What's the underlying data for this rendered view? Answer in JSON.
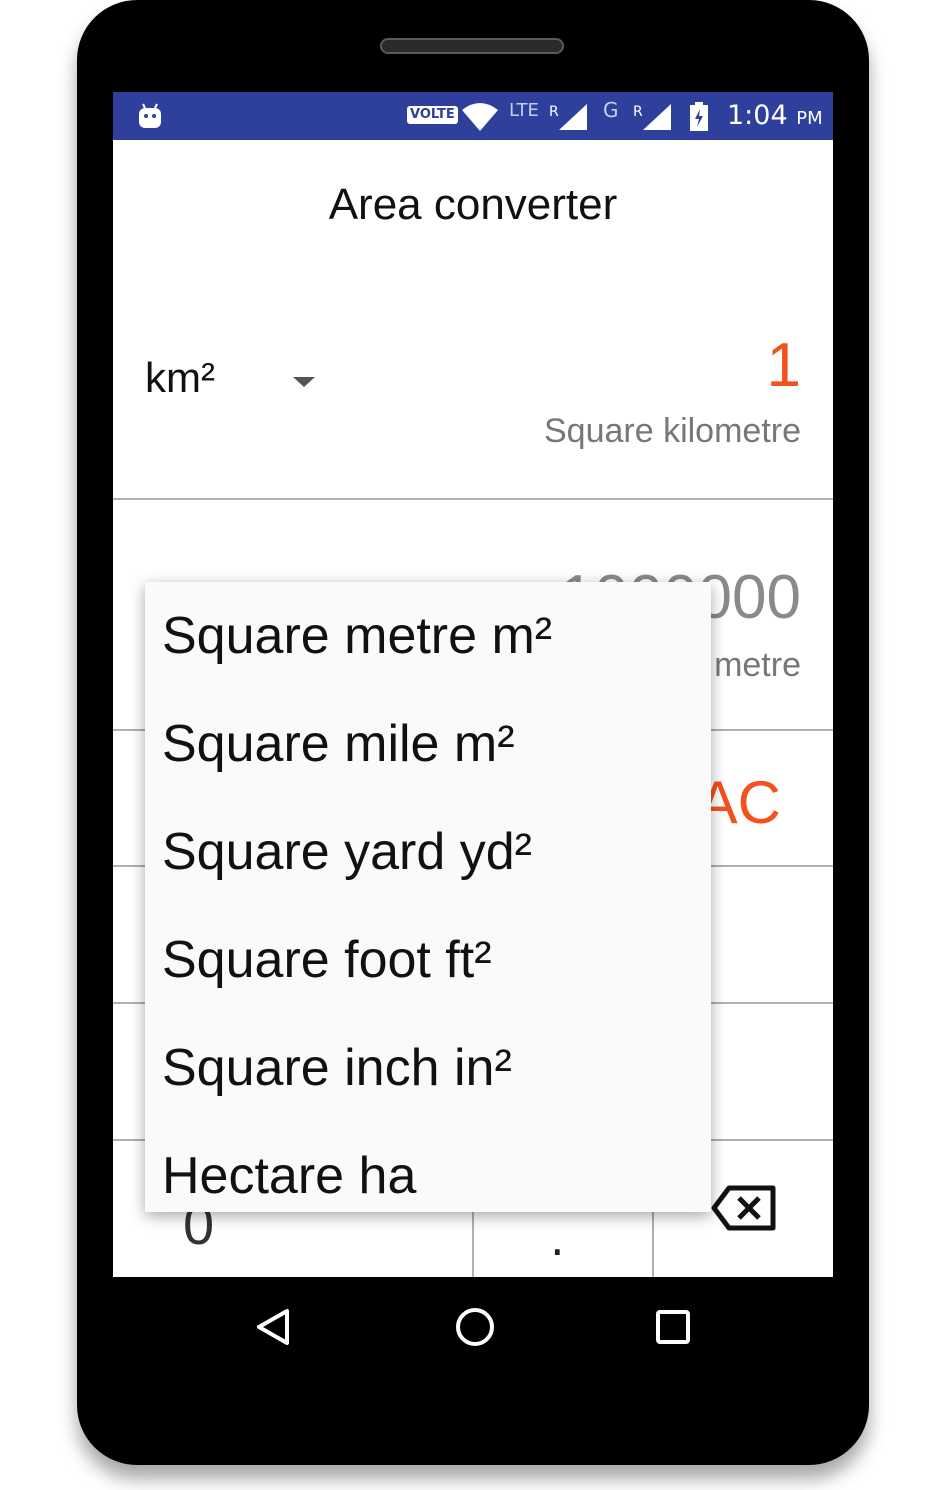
{
  "status_bar": {
    "volte": "VOLTE",
    "lte": "LTE",
    "roaming_1": "R",
    "network_2": "G",
    "roaming_2": "R",
    "time": "1:04",
    "ampm": "PM"
  },
  "app": {
    "title": "Area converter"
  },
  "from_unit": {
    "symbol": "km²",
    "value": "1",
    "name": "Square kilometre"
  },
  "to_unit": {
    "value": "1000000",
    "name_partial": "metre"
  },
  "keypad": {
    "ac": "AC",
    "zero": "0",
    "dot": "."
  },
  "dropdown_menu": {
    "items": [
      "Square metre m²",
      "Square mile m²",
      "Square yard yd²",
      "Square foot ft²",
      "Square inch in²",
      "Hectare ha"
    ]
  },
  "colors": {
    "status_bar": "#2f3f9c",
    "accent": "#f4511e"
  },
  "icons": {
    "status": [
      "android-icon",
      "wifi-icon",
      "signal-icon",
      "battery-charging-icon"
    ],
    "nav": [
      "back-icon",
      "home-icon",
      "recent-apps-icon"
    ]
  }
}
